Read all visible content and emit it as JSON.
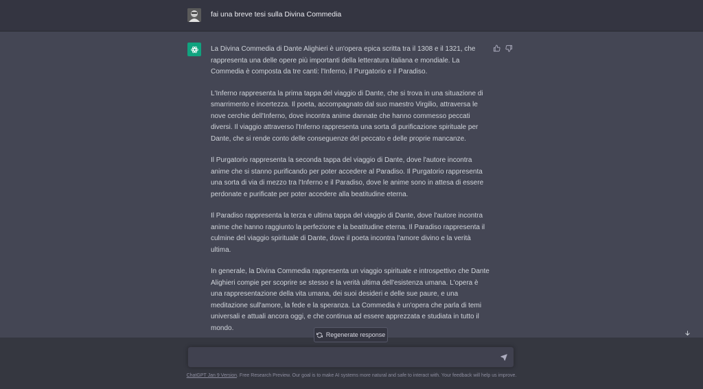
{
  "user_message": {
    "text": "fai una breve tesi sulla Divina Commedia"
  },
  "assistant_message": {
    "paragraphs": [
      "La Divina Commedia di Dante Alighieri è un'opera epica scritta tra il 1308 e il 1321, che rappresenta una delle opere più importanti della letteratura italiana e mondiale. La Commedia è composta da tre canti: l'Inferno, il Purgatorio e il Paradiso.",
      "L'Inferno rappresenta la prima tappa del viaggio di Dante, che si trova in una situazione di smarrimento e incertezza. Il poeta, accompagnato dal suo maestro Virgilio, attraversa le nove cerchie dell'Inferno, dove incontra anime dannate che hanno commesso peccati diversi. Il viaggio attraverso l'Inferno rappresenta una sorta di purificazione spirituale per Dante, che si rende conto delle conseguenze del peccato e delle proprie mancanze.",
      "Il Purgatorio rappresenta la seconda tappa del viaggio di Dante, dove l'autore incontra anime che si stanno purificando per poter accedere al Paradiso. Il Purgatorio rappresenta una sorta di via di mezzo tra l'Inferno e il Paradiso, dove le anime sono in attesa di essere perdonate e purificate per poter accedere alla beatitudine eterna.",
      "Il Paradiso rappresenta la terza e ultima tappa del viaggio di Dante, dove l'autore incontra anime che hanno raggiunto la perfezione e la beatitudine eterna. Il Paradiso rappresenta il culmine del viaggio spirituale di Dante, dove il poeta incontra l'amore divino e la verità ultima.",
      "In generale, la Divina Commedia rappresenta un viaggio spirituale e introspettivo che Dante Alighieri compie per scoprire se stesso e la verità ultima dell'esistenza umana. L'opera è una rappresentazione della vita umana, dei suoi desideri e delle sue paure, e una meditazione sull'amore, la fede e la speranza. La Commedia è un'opera che parla di temi universali e attuali ancora oggi, e che continua ad essere apprezzata e studiata in tutto il mondo."
    ]
  },
  "actions": {
    "regenerate_label": "Regenerate response"
  },
  "input": {
    "value": "",
    "placeholder": ""
  },
  "footer": {
    "version_link": "ChatGPT Jan 9 Version",
    "text": ". Free Research Preview. Our goal is to make AI systems more natural and safe to interact with. Your feedback will help us improve."
  },
  "icons": {
    "thumbs_up": "thumbs-up-icon",
    "thumbs_down": "thumbs-down-icon",
    "regenerate": "refresh-icon",
    "send": "send-icon",
    "scroll_down": "arrow-down-icon",
    "bot": "openai-logo-icon"
  },
  "colors": {
    "background": "#343541",
    "assistant_background": "#444654",
    "bot_avatar": "#10a37f",
    "input_background": "#40414f"
  }
}
